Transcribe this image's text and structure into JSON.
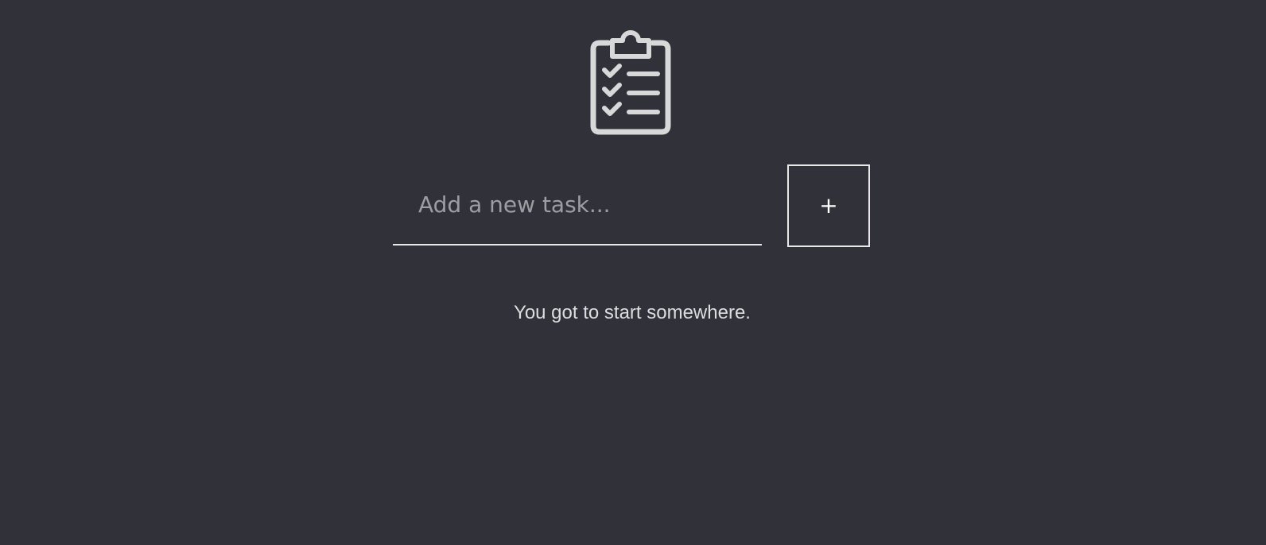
{
  "app": {
    "icon": "clipboard-checklist-icon"
  },
  "task_form": {
    "input": {
      "value": "",
      "placeholder": "Add a new task..."
    },
    "add_button_label": "+"
  },
  "empty_state": {
    "message": "You got to start somewhere."
  },
  "colors": {
    "background": "#313139",
    "foreground": "#d8d8d8",
    "placeholder": "#9d9da2",
    "border": "#e8e8e8"
  }
}
